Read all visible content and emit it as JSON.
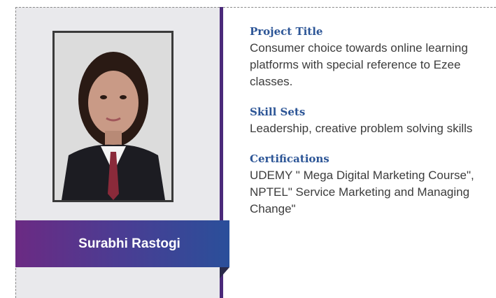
{
  "profile": {
    "name": "Surabhi Rastogi"
  },
  "sections": [
    {
      "heading": "Project Title",
      "body": "Consumer choice towards online learning platforms with special reference to Ezee classes."
    },
    {
      "heading": "Skill Sets",
      "body": "Leadership, creative problem solving skills"
    },
    {
      "heading": "Certifications",
      "body": "UDEMY \" Mega Digital Marketing Course\", NPTEL\" Service Marketing and Managing Change\""
    }
  ],
  "colors": {
    "heading": "#2c5596",
    "accent_bar": "#4b2a7a",
    "panel": "#e9e9ec",
    "band_start": "#6b2a83",
    "band_end": "#2a4f9a"
  }
}
